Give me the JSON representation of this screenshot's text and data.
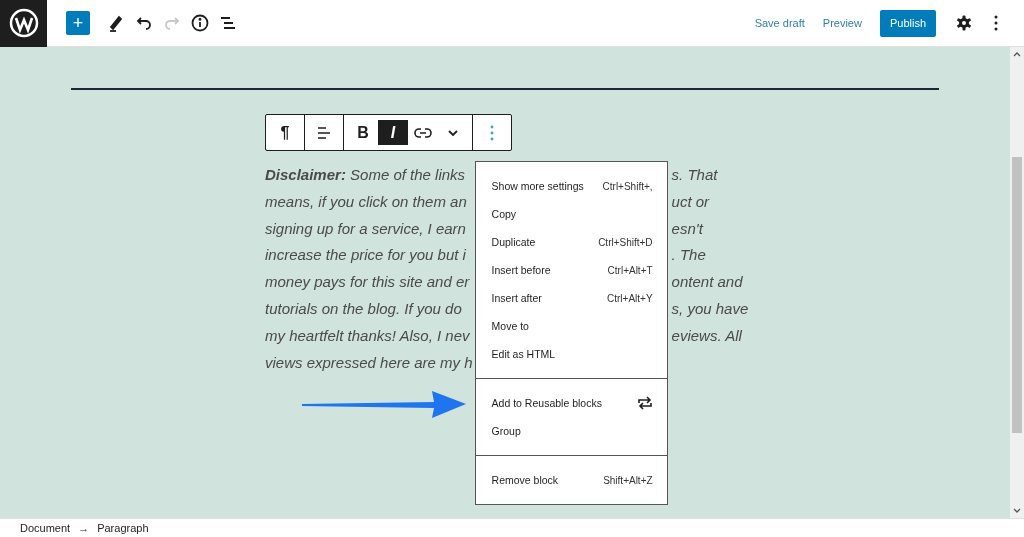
{
  "header": {
    "tools": [
      {
        "kind": "inserter",
        "label": "+",
        "disabled": false
      },
      {
        "kind": "edit",
        "disabled": false
      },
      {
        "kind": "undo",
        "disabled": false
      },
      {
        "kind": "redo",
        "disabled": true
      },
      {
        "kind": "info",
        "disabled": false
      },
      {
        "kind": "outline",
        "disabled": false
      }
    ],
    "actions": [
      {
        "kind": "link",
        "label": "Save draft"
      },
      {
        "kind": "link",
        "label": "Preview"
      },
      {
        "kind": "primary",
        "label": "Publish"
      }
    ]
  },
  "block_toolbar": {
    "groups": [
      [
        {
          "kind": "glyph",
          "label": "¶",
          "selected": false
        }
      ],
      [
        {
          "kind": "align",
          "selected": false
        }
      ],
      [
        {
          "kind": "glyph",
          "label": "B",
          "selected": false
        },
        {
          "kind": "glyph",
          "label": "I",
          "selected": true
        },
        {
          "kind": "link",
          "selected": false
        },
        {
          "kind": "more",
          "selected": false
        }
      ],
      [
        {
          "kind": "options",
          "selected": true
        }
      ]
    ]
  },
  "paragraph": {
    "left": [
      "**Disclaimer:** Some of the links ",
      "means, if you click on them an",
      "signing up for a service, I earn",
      "increase the price for you but i",
      "money pays for this site and er",
      "tutorials on the blog. If you do",
      "my heartfelt thanks! Also, I nev",
      "views expressed here are my h"
    ],
    "right": [
      "s. That",
      "uct or",
      "esn't",
      ". The",
      "ontent and",
      "s, you have",
      "eviews. All"
    ]
  },
  "menu": {
    "sections": [
      [
        {
          "label": "Show more settings",
          "kind": "shortcut",
          "shortcut": "Ctrl+Shift+,"
        },
        {
          "label": "Copy",
          "kind": "plain"
        },
        {
          "label": "Duplicate",
          "kind": "shortcut",
          "shortcut": "Ctrl+Shift+D"
        },
        {
          "label": "Insert before",
          "kind": "shortcut",
          "shortcut": "Ctrl+Alt+T"
        },
        {
          "label": "Insert after",
          "kind": "shortcut",
          "shortcut": "Ctrl+Alt+Y"
        },
        {
          "label": "Move to",
          "kind": "plain"
        },
        {
          "label": "Edit as HTML",
          "kind": "plain"
        }
      ],
      [
        {
          "label": "Add to Reusable blocks",
          "kind": "icon"
        },
        {
          "label": "Group",
          "kind": "plain"
        }
      ],
      [
        {
          "label": "Remove block",
          "kind": "shortcut",
          "shortcut": "Shift+Alt+Z"
        }
      ]
    ]
  },
  "breadcrumb": {
    "items": [
      "Document",
      "Paragraph"
    ],
    "separator": "→"
  }
}
